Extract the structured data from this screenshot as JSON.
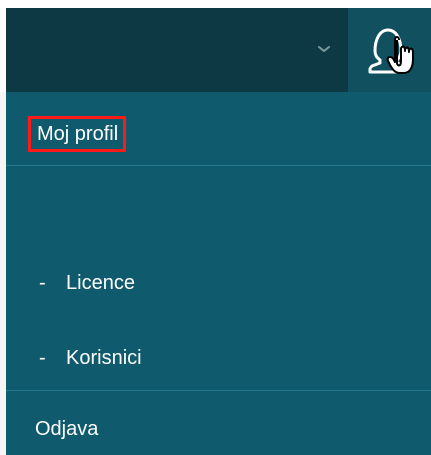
{
  "header": {
    "dropdown_icon": "chevron-down-icon",
    "user_icon": "user-icon"
  },
  "menu": {
    "profile_label": "Moj profil",
    "items": [
      {
        "dash": "-",
        "label": "Licence"
      },
      {
        "dash": "-",
        "label": "Korisnici"
      }
    ],
    "logout_label": "Odjava"
  },
  "colors": {
    "topbar": "#0d3944",
    "menu_background": "#0f5a6c",
    "user_button": "#10505f",
    "highlight": "#ff1a1a",
    "text": "#ffffff"
  }
}
